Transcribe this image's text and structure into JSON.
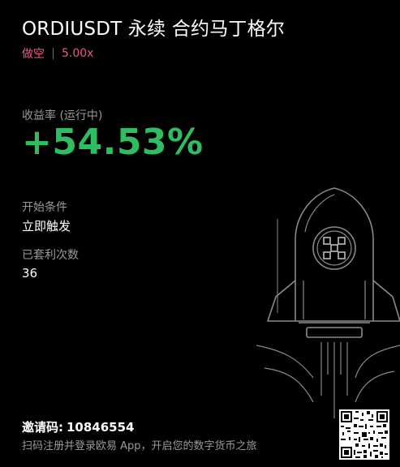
{
  "header": {
    "title": "ORDIUSDT 永续 合约马丁格尔",
    "direction": "做空",
    "leverage": "5.00x"
  },
  "pnl": {
    "label": "收益率 (运行中)",
    "value": "+54.53%"
  },
  "start_condition": {
    "label": "开始条件",
    "value": "立即触发"
  },
  "arbitrage_count": {
    "label": "已套利次数",
    "value": "36"
  },
  "footer": {
    "invite_label": "邀请码:",
    "invite_code": "10846554",
    "tagline": "扫码注册并登录欧易 App，开启您的数字货币之旅"
  },
  "colors": {
    "background": "#000000",
    "short": "#e85a86",
    "profit": "#2ebd61",
    "muted": "#9a9a9a"
  },
  "icons": [
    "rocket-illustration-icon",
    "okx-logo-icon",
    "qr-code-icon"
  ]
}
